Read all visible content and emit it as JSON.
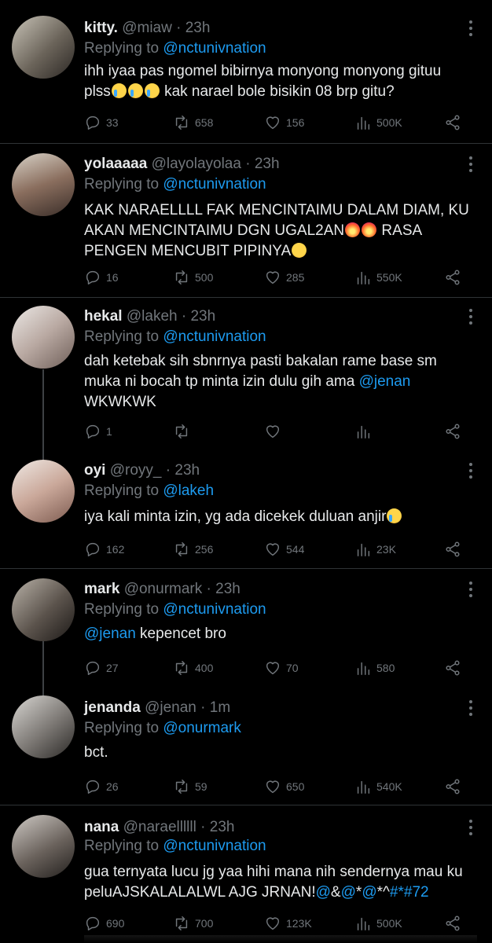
{
  "tweets": [
    {
      "name": "kitty.",
      "handle": "@miaw",
      "time": "23h",
      "replying_prefix": "Replying to",
      "replying_to": "@nctunivnation",
      "text_a": "ihh iyaa pas ngomel bibirnya monyong monyong gituu",
      "text_b": "plss",
      "text_c": " kak narael bole bisikin 08 brp gitu?",
      "replies": "33",
      "retweets": "658",
      "likes": "156",
      "views": "500K"
    },
    {
      "name": "yolaaaaa",
      "handle": "@layolayolaa",
      "time": "23h",
      "replying_prefix": "Replying to",
      "replying_to": "@nctunivnation",
      "text_a": "KAK NARAELLLL FAK MENCINTAIMU DALAM DIAM, KU",
      "text_b": "AKAN MENCINTAIMU DGN UGAL2AN",
      "text_c": " RASA",
      "text_d": "PENGEN MENCUBIT PIPINYA",
      "replies": "16",
      "retweets": "500",
      "likes": "285",
      "views": "550K"
    },
    {
      "name": "hekal",
      "handle": "@lakeh",
      "time": "23h",
      "replying_prefix": "Replying to",
      "replying_to": "@nctunivnation",
      "text_a": "dah ketebak sih sbnrnya pasti bakalan rame base sm",
      "text_b": "muka ni bocah tp minta izin dulu gih ama ",
      "text_mention": "@jenan",
      "text_c": "WKWKWK",
      "replies": "1"
    },
    {
      "name": "oyi",
      "handle": "@royy_",
      "time": "23h",
      "replying_prefix": "Replying to",
      "replying_to": "@lakeh",
      "text_a": "iya kali minta izin, yg ada dicekek duluan anjir",
      "replies": "162",
      "retweets": "256",
      "likes": "544",
      "views": "23K"
    },
    {
      "name": "mark",
      "handle": "@onurmark",
      "time": "23h",
      "replying_prefix": "Replying to",
      "replying_to": "@nctunivnation",
      "text_mention": "@jenan",
      "text_a": " kepencet bro",
      "replies": "27",
      "retweets": "400",
      "likes": "70",
      "views": "580"
    },
    {
      "name": "jenanda",
      "handle": "@jenan",
      "time": "1m",
      "replying_prefix": "Replying to",
      "replying_to": "@onurmark",
      "text_a": "bct.",
      "replies": "26",
      "retweets": "59",
      "likes": "650",
      "views": "540K"
    },
    {
      "name": "nana",
      "handle": "@naraellllll",
      "time": "23h",
      "replying_prefix": "Replying to",
      "replying_to": "@nctunivnation",
      "text_a": "gua ternyata lucu jg yaa hihi mana nih sendernya mau ku",
      "text_b": "peluAJSKALALALWL AJG JRNAN!",
      "text_c": "@",
      "text_d": "&",
      "text_e": "@",
      "text_f": "*",
      "text_g": "@",
      "text_h": "*^",
      "text_i": "#*",
      "text_j": "#72",
      "replies": "690",
      "retweets": "700",
      "likes": "123K",
      "views": "500K"
    }
  ],
  "icons": {
    "reply": "reply-icon",
    "retweet": "retweet-icon",
    "like": "heart-icon",
    "views": "views-icon",
    "share": "share-icon",
    "more": "more-icon"
  },
  "colors": {
    "background": "#000000",
    "accent": "#1d9bf0",
    "muted": "#71767b",
    "text": "#e7e9ea"
  }
}
